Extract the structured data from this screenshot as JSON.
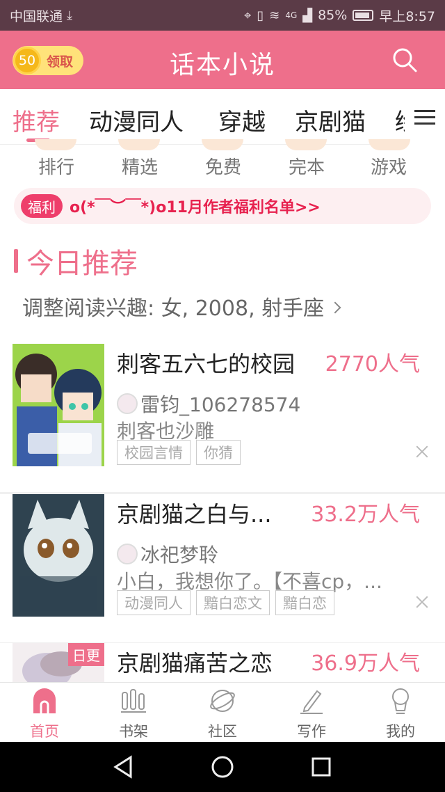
{
  "status_bar": {
    "carrier": "中国联通",
    "net": "4G",
    "battery": "85%",
    "time": "早上8:57"
  },
  "header": {
    "coins": "50",
    "reward_label": "领取",
    "title": "话本小说"
  },
  "tabs": [
    {
      "label": "推荐"
    },
    {
      "label": "动漫同人"
    },
    {
      "label": "穿越"
    },
    {
      "label": "京剧猫"
    },
    {
      "label": "绘"
    }
  ],
  "quick_links": [
    {
      "label": "排行"
    },
    {
      "label": "精选"
    },
    {
      "label": "免费"
    },
    {
      "label": "完本"
    },
    {
      "label": "游戏"
    }
  ],
  "notice": {
    "tag": "福利",
    "text": "o(*￣︶￣*)o11月作者福利名单>>"
  },
  "section": {
    "title": "今日推荐",
    "interest": "调整阅读兴趣: 女, 2008, 射手座"
  },
  "books": [
    {
      "title": "刺客五六七的校园",
      "popularity": "2770人气",
      "author": "雷钧_106278574",
      "desc": "刺客也沙雕",
      "tags": [
        "校园言情",
        "你猜"
      ]
    },
    {
      "title": "京剧猫之白与...",
      "popularity": "33.2万人气",
      "author": "冰祀梦聆",
      "desc": "小白，我想你了。【不喜cp，...",
      "tags": [
        "动漫同人",
        "黯白恋文",
        "黯白恋"
      ]
    },
    {
      "title": "京剧猫痛苦之恋",
      "popularity": "36.9万人气",
      "badge": "日更"
    }
  ],
  "bottom_nav": [
    {
      "label": "首页"
    },
    {
      "label": "书架"
    },
    {
      "label": "社区"
    },
    {
      "label": "写作"
    },
    {
      "label": "我的"
    }
  ],
  "colors": {
    "primary": "#ee6f8b",
    "status_bar": "#5b3b47"
  }
}
